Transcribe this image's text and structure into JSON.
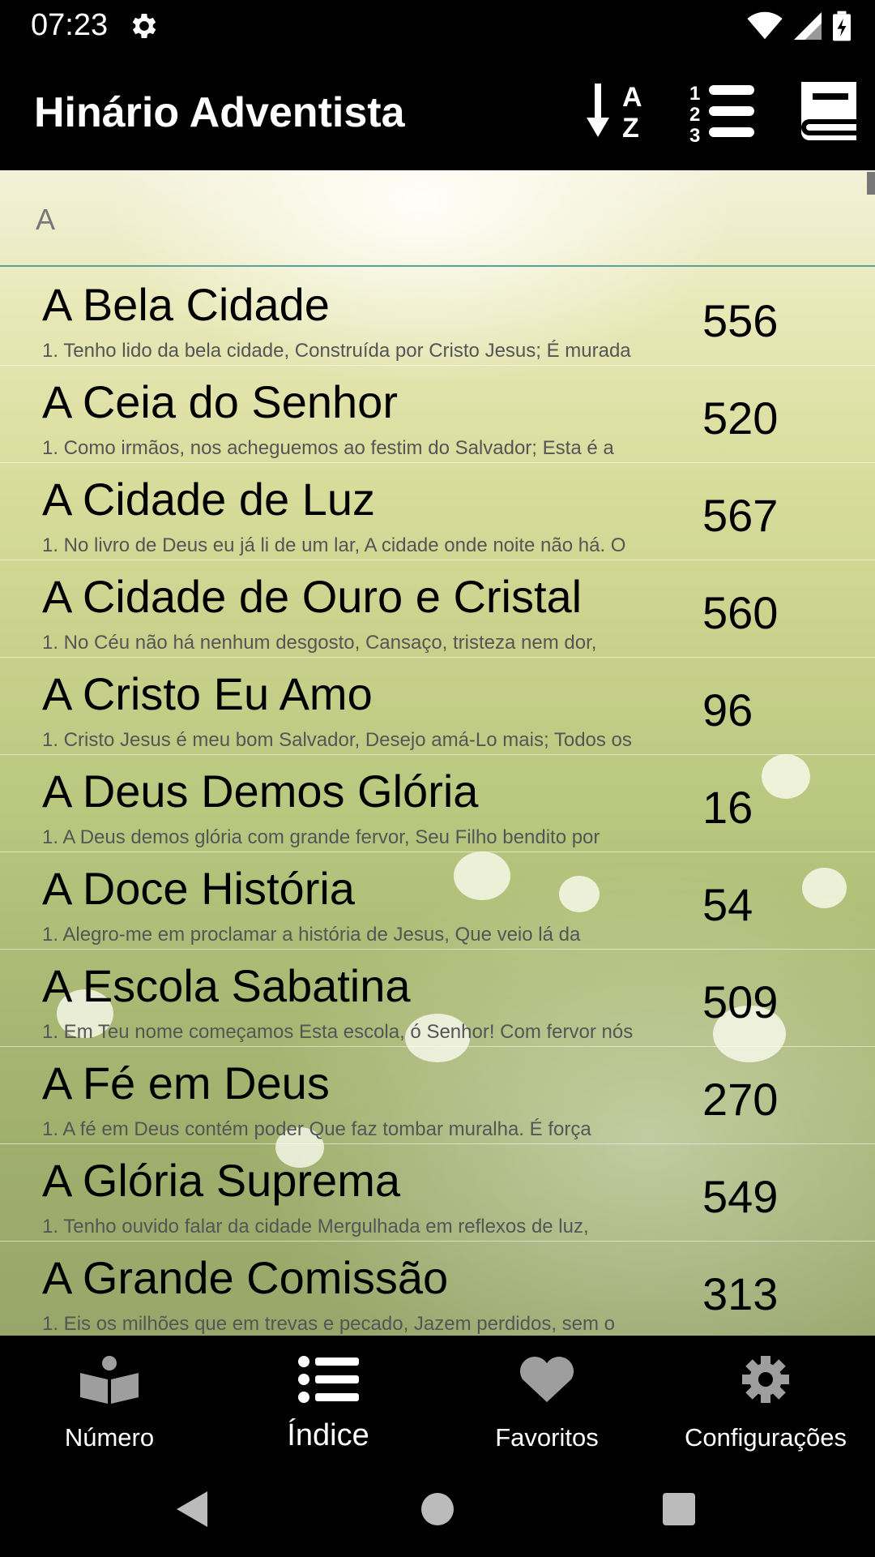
{
  "status": {
    "time": "07:23"
  },
  "app": {
    "title": "Hinário Adventista"
  },
  "section": {
    "letter": "A"
  },
  "hymns": [
    {
      "title": "A Bela Cidade",
      "snippet": "1. Tenho lido da bela cidade, Construída por Cristo Jesus; É murada",
      "number": "556"
    },
    {
      "title": "A Ceia do Senhor",
      "snippet": "1. Como irmãos, nos acheguemos ao festim do Salvador; Esta é a",
      "number": "520"
    },
    {
      "title": "A Cidade de Luz",
      "snippet": "1. No livro de Deus eu já li de um lar, A cidade onde noite não há. O",
      "number": "567"
    },
    {
      "title": "A Cidade de Ouro e Cristal",
      "snippet": "1. No Céu não há nenhum desgosto, Cansaço, tristeza nem dor,",
      "number": "560"
    },
    {
      "title": "A Cristo Eu Amo",
      "snippet": "1. Cristo Jesus é meu bom Salvador, Desejo amá-Lo mais; Todos os",
      "number": "96"
    },
    {
      "title": "A Deus Demos Glória",
      "snippet": "1. A Deus demos glória com grande fervor, Seu Filho bendito por",
      "number": "16"
    },
    {
      "title": "A Doce História",
      "snippet": "1. Alegro-me em proclamar a história de Jesus, Que veio lá da",
      "number": "54"
    },
    {
      "title": "A Escola Sabatina",
      "snippet": "1. Em Teu nome começamos Esta escola, ó Senhor! Com fervor nós",
      "number": "509"
    },
    {
      "title": "A Fé em Deus",
      "snippet": "1. A fé em Deus contém poder Que faz tombar muralha. É força",
      "number": "270"
    },
    {
      "title": "A Glória Suprema",
      "snippet": "1. Tenho ouvido falar da cidade Mergulhada em reflexos de luz,",
      "number": "549"
    },
    {
      "title": "A Grande Comissão",
      "snippet": "1. Eis os milhões que em trevas e pecado, Jazem perdidos, sem o",
      "number": "313"
    }
  ],
  "bottom_nav": [
    {
      "label": "Número",
      "icon": "open-book-icon",
      "active": false
    },
    {
      "label": "Índice",
      "icon": "list-icon",
      "active": true
    },
    {
      "label": "Favoritos",
      "icon": "heart-icon",
      "active": false
    },
    {
      "label": "Configurações",
      "icon": "gear-icon",
      "active": false
    }
  ],
  "colors": {
    "divider": "#5aa39d",
    "nav_inactive": "#9e9e9e",
    "nav_active": "#ffffff"
  }
}
